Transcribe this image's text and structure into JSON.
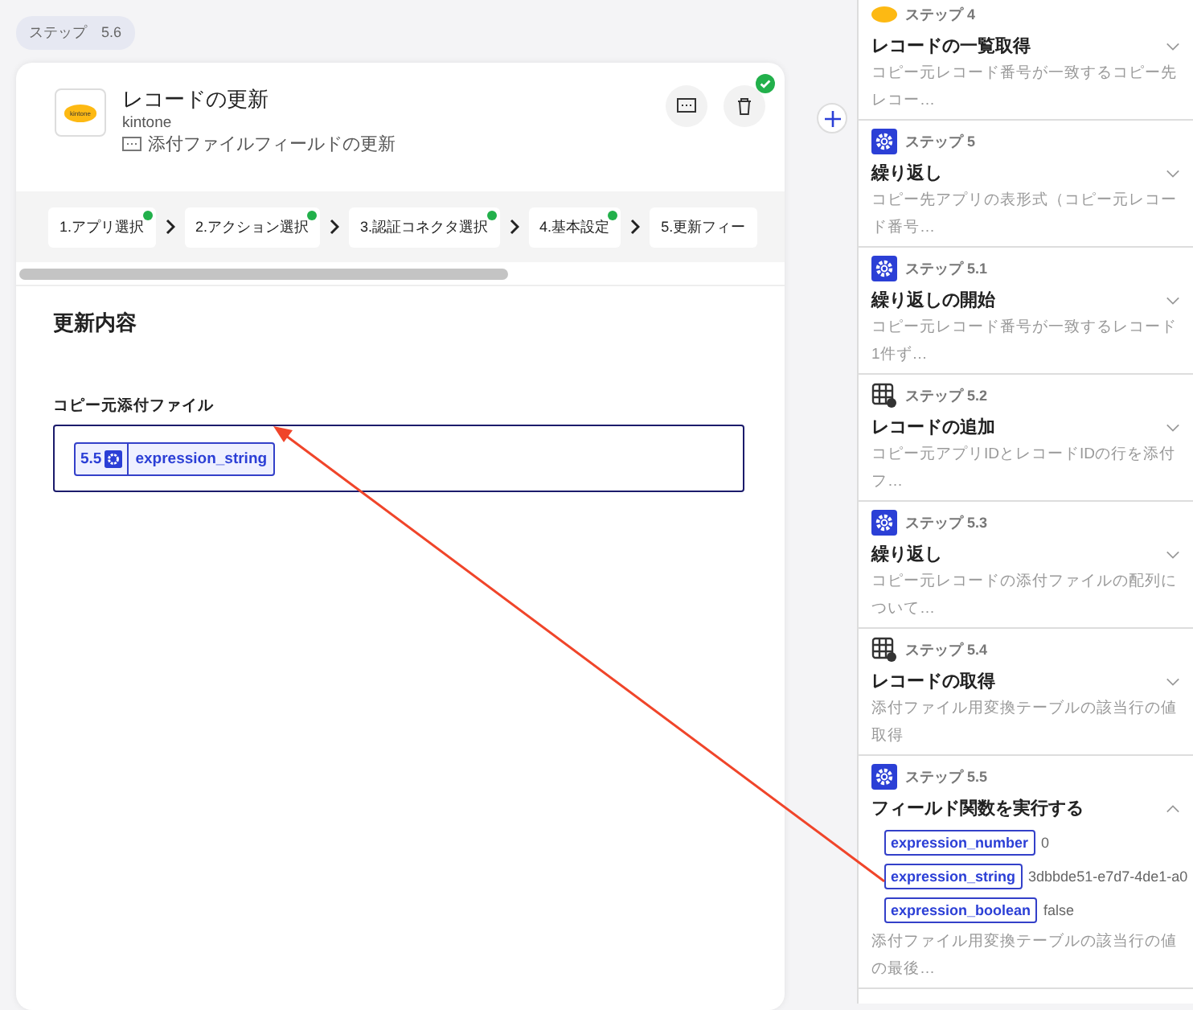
{
  "step_badge": "ステップ　5.6",
  "card": {
    "title": "レコードの更新",
    "app": "kintone",
    "logo_text": "kintone",
    "memo": "添付ファイルフィールドの更新",
    "completed": true,
    "wizard": [
      {
        "label": "1.アプリ選択",
        "done": true
      },
      {
        "label": "2.アクション選択",
        "done": true
      },
      {
        "label": "3.認証コネクタ選択",
        "done": true
      },
      {
        "label": "4.基本設定",
        "done": true
      },
      {
        "label": "5.更新フィー",
        "done": false
      }
    ],
    "section_title": "更新内容",
    "field": {
      "label": "コピー元添付ファイル",
      "token": {
        "step": "5.5",
        "name": "expression_string"
      }
    }
  },
  "steps": [
    {
      "kind": "kintone",
      "label": "ステップ 4",
      "title": "レコードの一覧取得",
      "description": "コピー元レコード番号が一致するコピー先レコー…",
      "expanded": false
    },
    {
      "kind": "gear",
      "label": "ステップ 5",
      "title": "繰り返し",
      "description": "コピー先アプリの表形式（コピー元レコード番号…",
      "expanded": false
    },
    {
      "kind": "gear",
      "label": "ステップ 5.1",
      "title": "繰り返しの開始",
      "description": "コピー元レコード番号が一致するレコード1件ず…",
      "expanded": false
    },
    {
      "kind": "table",
      "label": "ステップ 5.2",
      "title": "レコードの追加",
      "description": "コピー元アプリIDとレコードIDの行を添付フ…",
      "expanded": false
    },
    {
      "kind": "gear",
      "label": "ステップ 5.3",
      "title": "繰り返し",
      "description": "コピー元レコードの添付ファイルの配列について…",
      "expanded": false
    },
    {
      "kind": "table",
      "label": "ステップ 5.4",
      "title": "レコードの取得",
      "description": "添付ファイル用変換テーブルの該当行の値取得",
      "expanded": false
    },
    {
      "kind": "gear",
      "label": "ステップ 5.5",
      "title": "フィールド関数を実行する",
      "description": "添付ファイル用変換テーブルの該当行の値の最後…",
      "expanded": true,
      "outputs": [
        {
          "name": "expression_number",
          "value": "0"
        },
        {
          "name": "expression_string",
          "value": "3dbbde51-e7d7-4de1-a0"
        },
        {
          "name": "expression_boolean",
          "value": "false"
        }
      ]
    }
  ]
}
